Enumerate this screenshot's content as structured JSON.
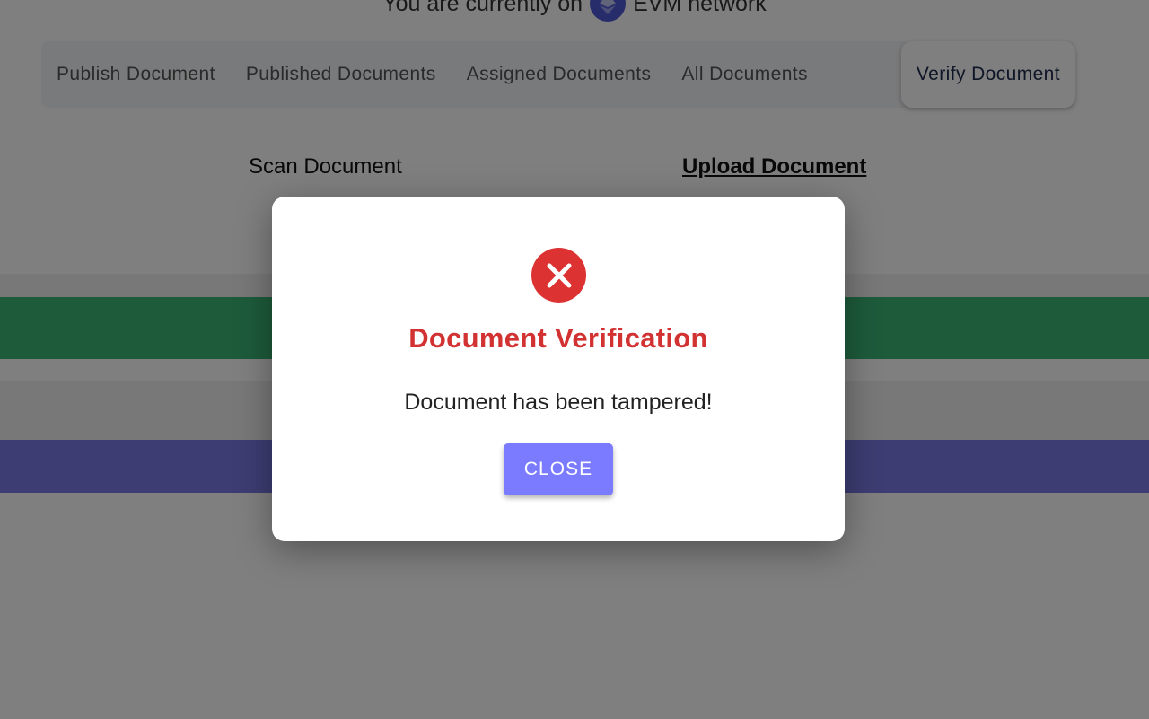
{
  "network": {
    "prefix": "You are currently on",
    "name": "EVM network",
    "icon": "ethereum-icon",
    "badge_color": "#4f5bd5"
  },
  "tabs": [
    {
      "label": "Publish Document"
    },
    {
      "label": "Published Documents"
    },
    {
      "label": "Assigned Documents"
    },
    {
      "label": "All Documents"
    },
    {
      "label": "Verify Document",
      "active": true
    }
  ],
  "subtabs": {
    "scan": "Scan Document",
    "upload": "Upload Document"
  },
  "modal": {
    "icon": "error-x-icon",
    "title": "Document Verification",
    "message": "Document has been tampered!",
    "close_label": "CLOSE",
    "title_color": "#d23232",
    "button_color": "#7b7bff"
  },
  "colors": {
    "green_band": "#3bb676",
    "blue_band": "#7a7ae6"
  }
}
